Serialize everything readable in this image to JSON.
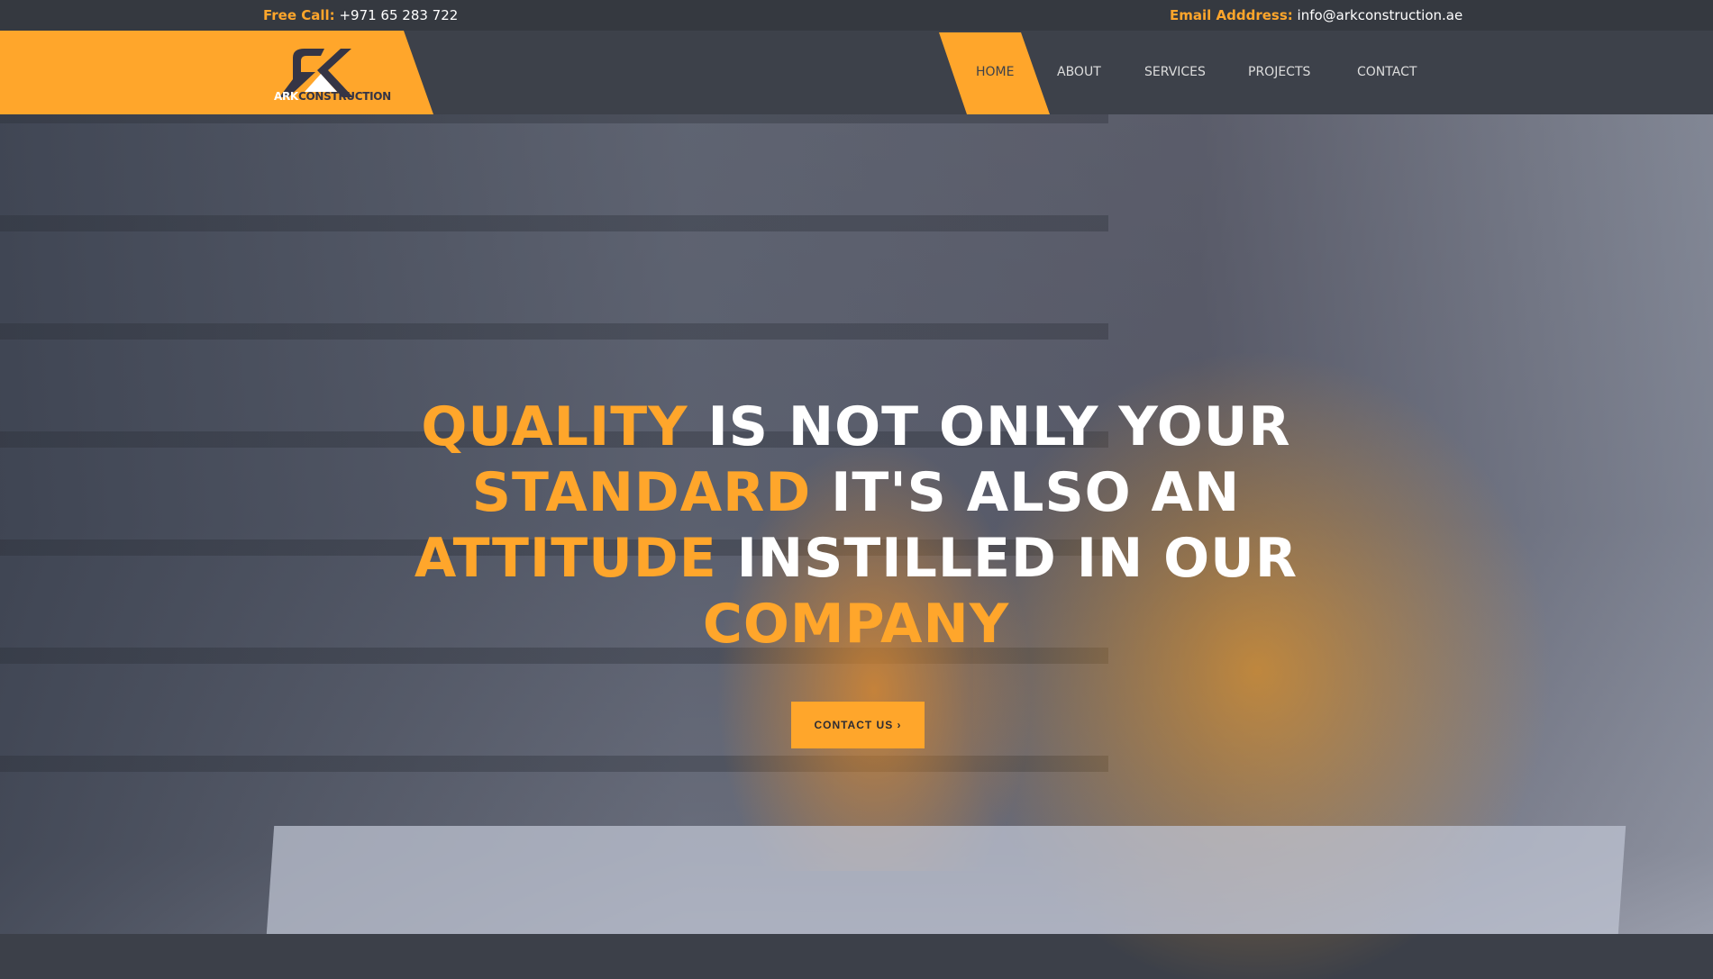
{
  "topbar": {
    "call_label": "Free Call:",
    "call_value": "+971 65 283 722",
    "email_label": "Email Adddress:",
    "email_value": "info@arkconstruction.ae"
  },
  "logo": {
    "text_a": "ARK",
    "text_b": "CONSTRUCTION"
  },
  "nav": {
    "items": [
      "HOME",
      "ABOUT",
      "SERVICES",
      "PROJECTS",
      "CONTACT"
    ],
    "active": "HOME"
  },
  "hero": {
    "line1_o": "QUALITY",
    "line1_w": "IS NOT ONLY YOUR",
    "line2_o": "STANDARD",
    "line2_w": "IT'S ALSO AN",
    "line3_o": "ATTITUDE",
    "line3_w": "INSTILLED IN OUR",
    "line4_o": "COMPANY",
    "button": "CONTACT US ›"
  },
  "colors": {
    "accent": "#ffa62b",
    "nav_bg": "#3d414a",
    "topbar_bg": "#353940"
  }
}
